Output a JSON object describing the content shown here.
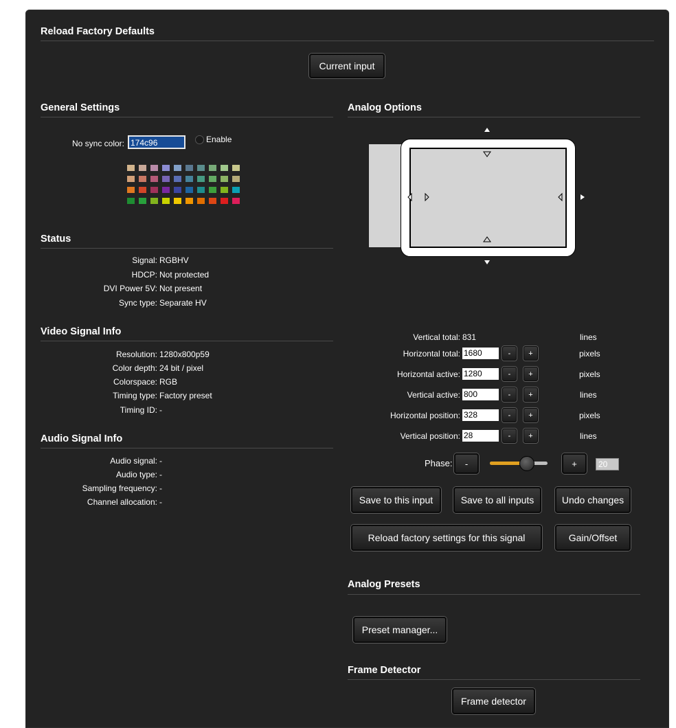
{
  "reload": {
    "title": "Reload Factory Defaults",
    "button": "Current input"
  },
  "general": {
    "title": "General Settings",
    "no_sync_label": "No sync color:",
    "no_sync_value": "174c96",
    "enable_label": "Enable",
    "palette": [
      [
        "#d2b48c",
        "#c8a898",
        "#b88aa8",
        "#8c8cd2",
        "#82a0c8",
        "#5a7890",
        "#5a8c8c",
        "#78aa78",
        "#a0c88c",
        "#c8c88c"
      ],
      [
        "#d2a078",
        "#c87864",
        "#b45a78",
        "#7864b4",
        "#5a6eb4",
        "#46829a",
        "#469a82",
        "#64aa64",
        "#8cb464",
        "#b4aa78"
      ],
      [
        "#e07820",
        "#d24628",
        "#a0325a",
        "#7828a0",
        "#3c46a0",
        "#1e64a0",
        "#1e8c8c",
        "#3ca03c",
        "#82b41e",
        "#0aa0b4"
      ],
      [
        "#1e8c32",
        "#28a03c",
        "#82b41e",
        "#c8d200",
        "#f0c800",
        "#f09600",
        "#e06e00",
        "#dc4614",
        "#dc1e1e",
        "#dc1e5a"
      ]
    ]
  },
  "status": {
    "title": "Status",
    "rows": [
      {
        "label": "Signal:",
        "value": "RGBHV"
      },
      {
        "label": "HDCP:",
        "value": "Not protected"
      },
      {
        "label": "DVI Power 5V:",
        "value": "Not present"
      },
      {
        "label": "Sync type:",
        "value": "Separate HV"
      }
    ]
  },
  "video": {
    "title": "Video Signal Info",
    "rows": [
      {
        "label": "Resolution:",
        "value": "1280x800p59"
      },
      {
        "label": "Color depth:",
        "value": "24 bit / pixel"
      },
      {
        "label": "Colorspace:",
        "value": "RGB"
      },
      {
        "label": "Timing type:",
        "value": "Factory preset"
      },
      {
        "label": "Timing ID:",
        "value": "-"
      }
    ]
  },
  "audio": {
    "title": "Audio Signal Info",
    "rows": [
      {
        "label": "Audio signal:",
        "value": "-"
      },
      {
        "label": "Audio type:",
        "value": "-"
      },
      {
        "label": "Sampling frequency:",
        "value": "-"
      },
      {
        "label": "Channel allocation:",
        "value": "-"
      }
    ]
  },
  "analog": {
    "title": "Analog Options",
    "vertical_total_label": "Vertical total:",
    "vertical_total_value": "831",
    "vertical_total_unit": "lines",
    "params": [
      {
        "label": "Horizontal total:",
        "value": "1680",
        "unit": "pixels"
      },
      {
        "label": "Horizontal active:",
        "value": "1280",
        "unit": "pixels"
      },
      {
        "label": "Vertical active:",
        "value": "800",
        "unit": "lines"
      },
      {
        "label": "Horizontal position:",
        "value": "328",
        "unit": "pixels"
      },
      {
        "label": "Vertical position:",
        "value": "28",
        "unit": "lines"
      }
    ],
    "minus": "-",
    "plus": "+",
    "phase_label": "Phase:",
    "phase_value": "20",
    "phase_fraction": 0.63,
    "buttons": {
      "save_this": "Save to this input",
      "save_all": "Save to all inputs",
      "undo": "Undo changes",
      "reload_signal": "Reload factory settings for this signal",
      "gain_offset": "Gain/Offset"
    }
  },
  "presets": {
    "title": "Analog Presets",
    "button": "Preset manager..."
  },
  "frame": {
    "title": "Frame Detector",
    "button": "Frame detector"
  }
}
